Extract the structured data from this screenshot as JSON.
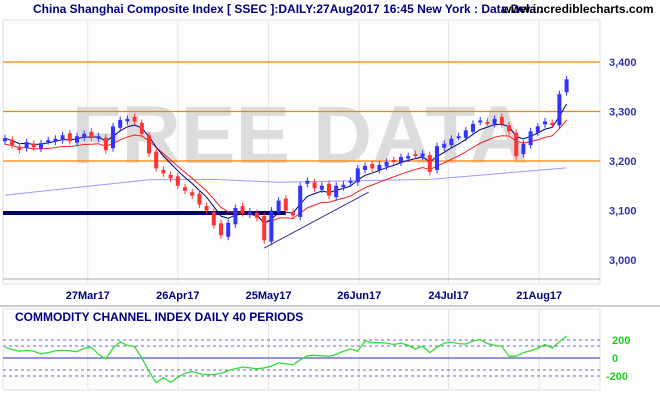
{
  "header": {
    "title": "China Shanghai Composite Index [ SSEC ]:DAILY:27Aug2017 16:45 New York : Data Dela..",
    "site": "www.incrediblecharts.com"
  },
  "watermark": "FREE DATA",
  "colors": {
    "up": "#3333ff",
    "down": "#ff3333",
    "level": "#ff8000",
    "fast_ma": "#000080",
    "slow_ma": "#ee2222",
    "long_ma": "#9999ff",
    "cci": "#33dd33",
    "grid": "#e4e4e4"
  },
  "chart_data": [
    {
      "type": "candlestick",
      "title": "China Shanghai Composite Index [ SSEC ] Daily",
      "ylabel": "",
      "ylim": [
        2960,
        3440
      ],
      "y_ticks": [
        {
          "v": 3400,
          "label": "3,400"
        },
        {
          "v": 3300,
          "label": "3,300"
        },
        {
          "v": 3200,
          "label": "3,200"
        },
        {
          "v": 3100,
          "label": "3,100"
        },
        {
          "v": 3000,
          "label": "3,000"
        }
      ],
      "x_ticks": [
        {
          "i": 11.5,
          "label": "27Mar17"
        },
        {
          "i": 24,
          "label": "26Apr17"
        },
        {
          "i": 36.6,
          "label": "25May17"
        },
        {
          "i": 49.2,
          "label": "26Jun17"
        },
        {
          "i": 61.6,
          "label": "24Jul17"
        },
        {
          "i": 74.2,
          "label": "21Aug17"
        }
      ],
      "closes": [
        3246,
        3232,
        3222,
        3238,
        3228,
        3236,
        3242,
        3245,
        3252,
        3240,
        3250,
        3255,
        3248,
        3250,
        3222,
        3270,
        3283,
        3285,
        3280,
        3255,
        3215,
        3185,
        3175,
        3165,
        3150,
        3140,
        3130,
        3112,
        3100,
        3070,
        3050,
        3075,
        3105,
        3095,
        3098,
        3085,
        3040,
        3100,
        3120,
        3100,
        3090,
        3150,
        3160,
        3145,
        3150,
        3130,
        3150,
        3152,
        3160,
        3185,
        3190,
        3185,
        3192,
        3198,
        3200,
        3208,
        3210,
        3212,
        3215,
        3178,
        3230,
        3235,
        3245,
        3250,
        3262,
        3275,
        3282,
        3278,
        3285,
        3275,
        3260,
        3210,
        3235,
        3260,
        3270,
        3280,
        3275,
        3335,
        3365
      ],
      "long_ma_points": [
        [
          0,
          3131
        ],
        [
          20,
          3162
        ],
        [
          29,
          3163
        ],
        [
          38,
          3157
        ],
        [
          59,
          3163
        ],
        [
          78,
          3186
        ]
      ],
      "horizontal_levels": [
        3400,
        3300,
        3200
      ],
      "support_line": {
        "value": 3095,
        "from_i": 0,
        "to_i": 39
      },
      "trendline": [
        [
          36,
          3024
        ],
        [
          50.5,
          3137
        ]
      ]
    },
    {
      "type": "line",
      "title": "COMMODITY CHANNEL INDEX DAILY 40 PERIODS",
      "ylim": [
        -350,
        350
      ],
      "y_ticks": [
        {
          "v": 200,
          "label": "200"
        },
        {
          "v": 0,
          "label": "0"
        },
        {
          "v": -200,
          "label": "-200"
        }
      ],
      "dashed_levels": [
        200,
        133,
        -133,
        -200
      ],
      "values": [
        120,
        95,
        75,
        85,
        75,
        45,
        60,
        80,
        85,
        80,
        70,
        110,
        120,
        40,
        -10,
        110,
        180,
        140,
        125,
        0,
        -150,
        -275,
        -220,
        -270,
        -215,
        -170,
        -150,
        -175,
        -185,
        -185,
        -170,
        -140,
        -120,
        -100,
        -110,
        -120,
        -110,
        -90,
        -55,
        -65,
        -75,
        -20,
        25,
        30,
        25,
        20,
        40,
        75,
        100,
        75,
        190,
        170,
        170,
        165,
        150,
        165,
        140,
        100,
        130,
        60,
        120,
        165,
        175,
        160,
        155,
        190,
        205,
        160,
        140,
        130,
        20,
        20,
        60,
        80,
        110,
        150,
        110,
        180,
        245
      ]
    }
  ]
}
